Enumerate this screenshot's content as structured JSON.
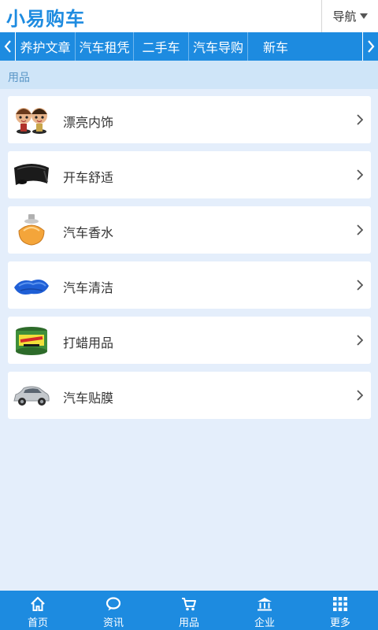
{
  "header": {
    "logo": "小易购车",
    "nav_label": "导航",
    "nav_icon": "caret-down-icon"
  },
  "category_bar": {
    "tabs": [
      {
        "label": "养护文章"
      },
      {
        "label": "汽车租凭"
      },
      {
        "label": "二手车"
      },
      {
        "label": "汽车导购"
      },
      {
        "label": "新车"
      }
    ],
    "left_icon": "chevron-left-icon",
    "right_icon": "chevron-right-icon"
  },
  "section": {
    "title": "用品"
  },
  "items": [
    {
      "label": "漂亮内饰",
      "icon": "bobblehead-dolls-thumb"
    },
    {
      "label": "开车舒适",
      "icon": "neck-pillow-thumb"
    },
    {
      "label": "汽车香水",
      "icon": "perfume-bottle-thumb"
    },
    {
      "label": "汽车清洁",
      "icon": "cleaning-towel-thumb"
    },
    {
      "label": "打蜡用品",
      "icon": "wax-tin-thumb"
    },
    {
      "label": "汽车贴膜",
      "icon": "silver-car-thumb"
    }
  ],
  "tabbar": {
    "tabs": [
      {
        "label": "首页",
        "icon": "home-icon"
      },
      {
        "label": "资讯",
        "icon": "chat-bubble-icon"
      },
      {
        "label": "用品",
        "icon": "cart-icon"
      },
      {
        "label": "企业",
        "icon": "building-icon"
      },
      {
        "label": "更多",
        "icon": "grid-icon"
      }
    ]
  },
  "colors": {
    "primary": "#1d8be0",
    "background": "#e4eefb",
    "section_bar": "#cfe5f8",
    "section_text": "#5a96c6"
  }
}
